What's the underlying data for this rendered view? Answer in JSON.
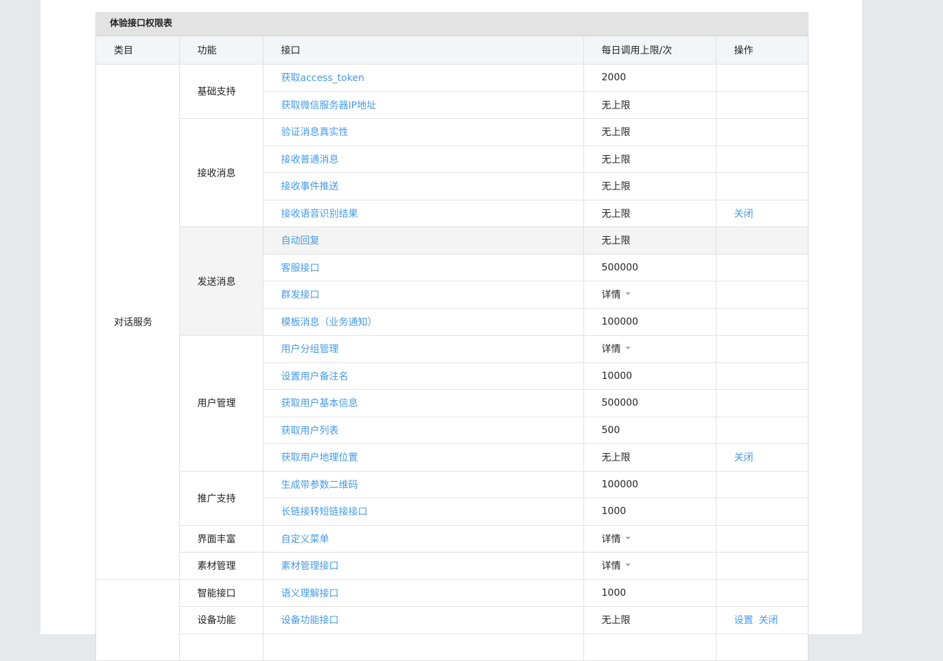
{
  "table_title": "体验接口权限表",
  "headers": {
    "category": "类目",
    "function": "功能",
    "api": "接口",
    "limit": "每日调用上限/次",
    "operation": "操作"
  },
  "categories": {
    "dialog": "对话服务"
  },
  "functions": {
    "basic": "基础支持",
    "receive": "接收消息",
    "send": "发送消息",
    "user": "用户管理",
    "promo": "推广支持",
    "ui": "界面丰富",
    "material": "素材管理",
    "smart": "智能接口",
    "device": "设备功能"
  },
  "rows": [
    {
      "api": "获取access_token",
      "limit": "2000"
    },
    {
      "api": "获取微信服务器IP地址",
      "limit": "无上限"
    },
    {
      "api": "验证消息真实性",
      "limit": "无上限"
    },
    {
      "api": "接收普通消息",
      "limit": "无上限"
    },
    {
      "api": "接收事件推送",
      "limit": "无上限"
    },
    {
      "api": "接收语音识别结果",
      "limit": "无上限",
      "op1": "关闭"
    },
    {
      "api": "自动回复",
      "limit": "无上限"
    },
    {
      "api": "客服接口",
      "limit": "500000"
    },
    {
      "api": "群发接口",
      "limit": "详情"
    },
    {
      "api": "模板消息（业务通知）",
      "limit": "100000"
    },
    {
      "api": "用户分组管理",
      "limit": "详情"
    },
    {
      "api": "设置用户备注名",
      "limit": "10000"
    },
    {
      "api": "获取用户基本信息",
      "limit": "500000"
    },
    {
      "api": "获取用户列表",
      "limit": "500"
    },
    {
      "api": "获取用户地理位置",
      "limit": "无上限",
      "op1": "关闭"
    },
    {
      "api": "生成带参数二维码",
      "limit": "100000"
    },
    {
      "api": "长链接转短链接接口",
      "limit": "1000"
    },
    {
      "api": "自定义菜单",
      "limit": "详情"
    },
    {
      "api": "素材管理接口",
      "limit": "详情"
    },
    {
      "api": "语义理解接口",
      "limit": "1000"
    },
    {
      "api": "设备功能接口",
      "limit": "无上限",
      "op1": "设置",
      "op2": "关闭"
    }
  ]
}
